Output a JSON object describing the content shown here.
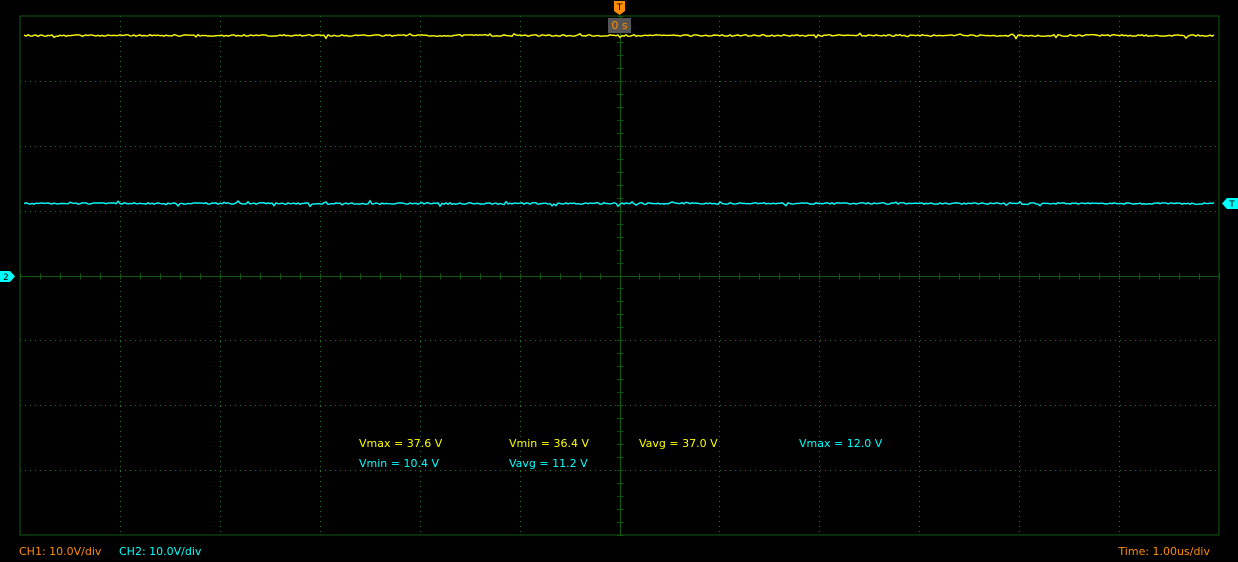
{
  "colors": {
    "ch1": "#ffff00",
    "ch2": "#00ffff",
    "grid": "#0f5a0f",
    "grid_dots": "#1f7a1f",
    "trigger": "#ff8c00",
    "background": "#000000"
  },
  "trigger": {
    "marker": "T",
    "time_label": "0 s",
    "level_marker": "T"
  },
  "ch2_ref_marker": "2",
  "measurements": {
    "r1": [
      "Vmax = 37.6 V",
      "Vmin = 36.4 V",
      "Vavg = 37.0 V",
      "Vmax = 12.0 V"
    ],
    "r2": [
      "Vmin = 10.4 V",
      "Vavg = 11.2 V"
    ]
  },
  "status": {
    "ch1_scale": "CH1: 10.0V/div",
    "ch2_scale": "CH2: 10.0V/div",
    "timebase": "Time: 1.00us/div"
  },
  "icons": [
    "trigger-time-marker-icon",
    "trigger-level-marker-icon",
    "ch2-ground-marker-icon"
  ]
}
